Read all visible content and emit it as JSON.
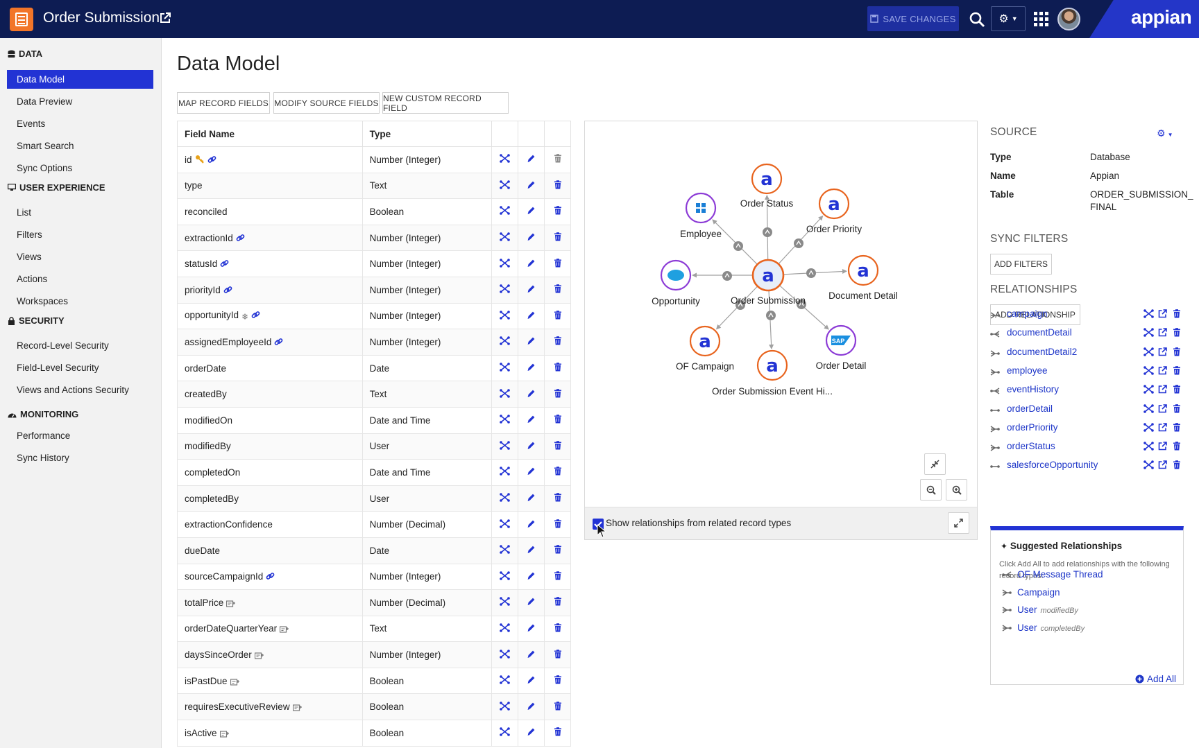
{
  "header": {
    "title": "Order Submission",
    "save_label": "SAVE CHANGES",
    "brand": "appian",
    "icons": [
      "record-icon",
      "external-link-icon",
      "search-icon",
      "gear-icon",
      "apps-grid-icon",
      "avatar"
    ]
  },
  "sidebar": {
    "sections": [
      {
        "label": "DATA",
        "icon": "database-icon"
      },
      {
        "label": "USER EXPERIENCE",
        "icon": "monitor-icon"
      },
      {
        "label": "SECURITY",
        "icon": "lock-icon"
      },
      {
        "label": "MONITORING",
        "icon": "dashboard-icon"
      }
    ],
    "items": [
      "Data Model",
      "Data Preview",
      "Events",
      "Smart Search",
      "Sync Options",
      "List",
      "Filters",
      "Views",
      "Actions",
      "Workspaces",
      "Record-Level Security",
      "Field-Level Security",
      "Views and Actions Security",
      "Performance",
      "Sync History"
    ]
  },
  "main": {
    "title": "Data Model",
    "toolbar": [
      "MAP RECORD FIELDS",
      "MODIFY SOURCE FIELDS",
      "NEW CUSTOM RECORD FIELD"
    ],
    "columns": [
      "Field Name",
      "Type"
    ],
    "rows": [
      {
        "name": "id",
        "type": "Number (Integer)",
        "badges": [
          "key",
          "link"
        ]
      },
      {
        "name": "type",
        "type": "Text",
        "badges": []
      },
      {
        "name": "reconciled",
        "type": "Boolean",
        "badges": []
      },
      {
        "name": "extractionId",
        "type": "Number (Integer)",
        "badges": [
          "link"
        ]
      },
      {
        "name": "statusId",
        "type": "Number (Integer)",
        "badges": [
          "link"
        ]
      },
      {
        "name": "priorityId",
        "type": "Number (Integer)",
        "badges": [
          "link"
        ]
      },
      {
        "name": "opportunityId",
        "type": "Number (Integer)",
        "badges": [
          "snowflake",
          "link"
        ]
      },
      {
        "name": "assignedEmployeeId",
        "type": "Number (Integer)",
        "badges": [
          "link"
        ]
      },
      {
        "name": "orderDate",
        "type": "Date",
        "badges": []
      },
      {
        "name": "createdBy",
        "type": "Text",
        "badges": []
      },
      {
        "name": "modifiedOn",
        "type": "Date and Time",
        "badges": []
      },
      {
        "name": "modifiedBy",
        "type": "User",
        "badges": []
      },
      {
        "name": "completedOn",
        "type": "Date and Time",
        "badges": []
      },
      {
        "name": "completedBy",
        "type": "User",
        "badges": []
      },
      {
        "name": "extractionConfidence",
        "type": "Number (Decimal)",
        "badges": []
      },
      {
        "name": "dueDate",
        "type": "Date",
        "badges": []
      },
      {
        "name": "sourceCampaignId",
        "type": "Number (Integer)",
        "badges": [
          "link"
        ]
      },
      {
        "name": "totalPrice",
        "type": "Number (Decimal)",
        "badges": [
          "custom"
        ]
      },
      {
        "name": "orderDateQuarterYear",
        "type": "Text",
        "badges": [
          "custom"
        ]
      },
      {
        "name": "daysSinceOrder",
        "type": "Number (Integer)",
        "badges": [
          "custom"
        ]
      },
      {
        "name": "isPastDue",
        "type": "Boolean",
        "badges": [
          "custom"
        ]
      },
      {
        "name": "requiresExecutiveReview",
        "type": "Boolean",
        "badges": [
          "custom"
        ]
      },
      {
        "name": "isActive",
        "type": "Boolean",
        "badges": [
          "custom"
        ]
      }
    ],
    "row_actions": [
      "relationship-icon",
      "pencil-icon",
      "trash-icon"
    ]
  },
  "diagram": {
    "center": "Order Submission",
    "nodes": [
      {
        "label": "Order Status",
        "kind": "appian"
      },
      {
        "label": "Order Priority",
        "kind": "appian"
      },
      {
        "label": "Document Detail",
        "kind": "appian"
      },
      {
        "label": "Order Detail",
        "kind": "sap"
      },
      {
        "label": "Order Submission Event Hi...",
        "kind": "appian"
      },
      {
        "label": "OF Campaign",
        "kind": "appian"
      },
      {
        "label": "Opportunity",
        "kind": "salesforce"
      },
      {
        "label": "Employee",
        "kind": "windows"
      }
    ],
    "show_related_label": "Show relationships from related record types",
    "show_related_checked": true,
    "accent_appian": "#e8641e",
    "accent_other": "#8c3bd6"
  },
  "source": {
    "heading": "SOURCE",
    "fields": [
      {
        "k": "Type",
        "v": "Database"
      },
      {
        "k": "Name",
        "v": "Appian"
      },
      {
        "k": "Table",
        "v": "ORDER_SUBMISSION_ FINAL"
      }
    ],
    "sync_filters_heading": "SYNC FILTERS",
    "add_filters_label": "ADD FILTERS",
    "relationships_heading": "RELATIONSHIPS",
    "add_relationship_label": "ADD RELATIONSHIP",
    "relationships": [
      {
        "name": "campaign",
        "kind": "many-to-one"
      },
      {
        "name": "documentDetail",
        "kind": "one-to-many"
      },
      {
        "name": "documentDetail2",
        "kind": "many-to-one"
      },
      {
        "name": "employee",
        "kind": "many-to-one"
      },
      {
        "name": "eventHistory",
        "kind": "one-to-many"
      },
      {
        "name": "orderDetail",
        "kind": "one-to-one"
      },
      {
        "name": "orderPriority",
        "kind": "many-to-one"
      },
      {
        "name": "orderStatus",
        "kind": "many-to-one"
      },
      {
        "name": "salesforceOpportunity",
        "kind": "one-to-one"
      }
    ]
  },
  "suggested": {
    "title": "Suggested Relationships",
    "description": "Click Add All to add relationships with the following record types:",
    "items": [
      {
        "name": "OF Message Thread",
        "sub": ""
      },
      {
        "name": "Campaign",
        "sub": ""
      },
      {
        "name": "User",
        "sub": "modifiedBy"
      },
      {
        "name": "User",
        "sub": "completedBy"
      }
    ],
    "add_all_label": "Add All"
  },
  "colors": {
    "header_bg": "#0d1c53",
    "accent_blue": "#2233d4",
    "link_blue": "#1e36c8",
    "orange": "#f27529"
  }
}
